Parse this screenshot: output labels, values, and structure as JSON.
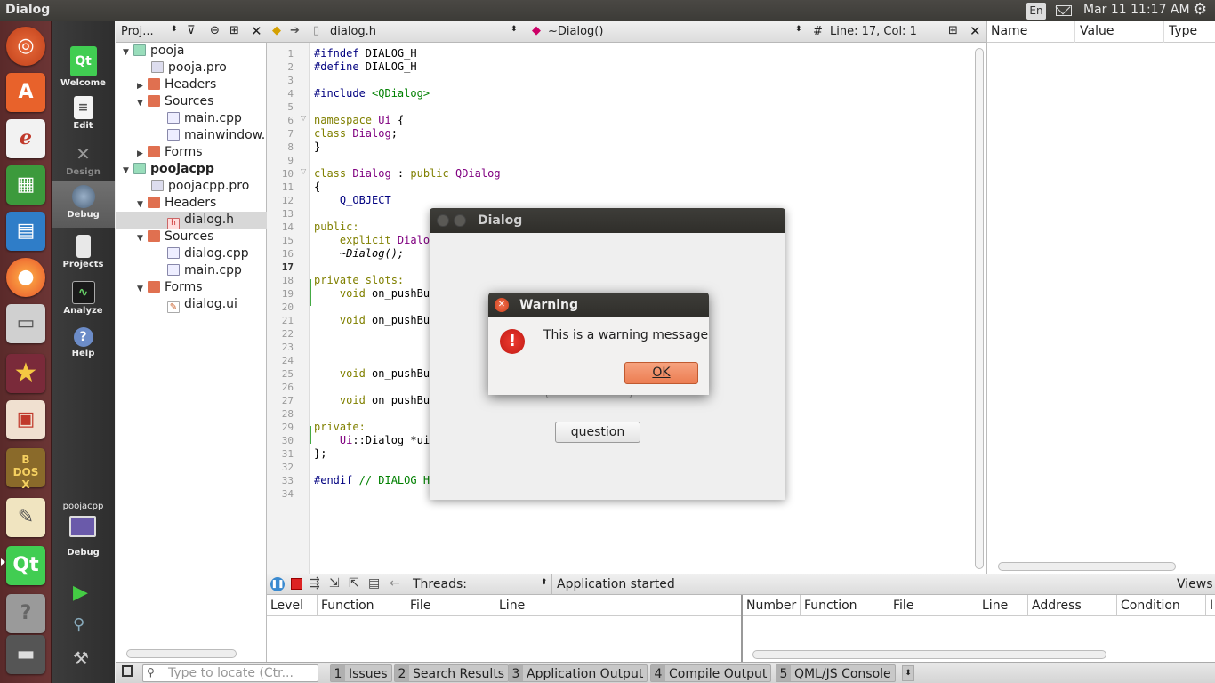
{
  "topbar": {
    "window_title": "Dialog",
    "keyboard": "En",
    "clock": "Mar 11 11:17 AM"
  },
  "modes": [
    {
      "label": "Welcome"
    },
    {
      "label": "Edit"
    },
    {
      "label": "Design"
    },
    {
      "label": "Debug"
    },
    {
      "label": "Projects"
    },
    {
      "label": "Analyze"
    },
    {
      "label": "Help"
    }
  ],
  "run_target": {
    "project": "poojacpp",
    "mode": "Debug"
  },
  "project_panel": {
    "filter_label": "Proj...",
    "tree": [
      {
        "label": "pooja",
        "bold": false
      },
      {
        "label": "pooja.pro"
      },
      {
        "label": "Headers"
      },
      {
        "label": "Sources"
      },
      {
        "label": "main.cpp"
      },
      {
        "label": "mainwindow."
      },
      {
        "label": "Forms"
      },
      {
        "label": "poojacpp",
        "bold": true
      },
      {
        "label": "poojacpp.pro"
      },
      {
        "label": "Headers"
      },
      {
        "label": "dialog.h"
      },
      {
        "label": "Sources"
      },
      {
        "label": "dialog.cpp"
      },
      {
        "label": "main.cpp"
      },
      {
        "label": "Forms"
      },
      {
        "label": "dialog.ui"
      }
    ]
  },
  "editor": {
    "file": "dialog.h",
    "symbol": "~Dialog()",
    "position": "Line: 17, Col: 1",
    "hash": "#",
    "line_numbers": [
      "1",
      "2",
      "3",
      "4",
      "5",
      "6",
      "7",
      "8",
      "9",
      "10",
      "11",
      "12",
      "13",
      "14",
      "15",
      "16",
      "17",
      "18",
      "19",
      "20",
      "21",
      "22",
      "23",
      "24",
      "25",
      "26",
      "27",
      "28",
      "29",
      "30",
      "31",
      "32",
      "33",
      "34"
    ],
    "lines": {
      "l1a": "#ifndef",
      "l1b": " DIALOG_H",
      "l2a": "#define",
      "l2b": " DIALOG_H",
      "l4a": "#include",
      "l4b": " <QDialog>",
      "l6a": "namespace",
      "l6b": " Ui",
      "l6c": " {",
      "l7a": "class",
      "l7b": " Dialog",
      "l7c": ";",
      "l8": "}",
      "l10a": "class",
      "l10b": " Dialog",
      "l10c": " : ",
      "l10d": "public",
      "l10e": " QDialog",
      "l11": "{",
      "l12": "    Q_OBJECT",
      "l14": "public:",
      "l15a": "    explicit",
      "l15b": " Dialo",
      "l16": "    ~Dialog();",
      "l18": "private slots:",
      "l19a": "    void",
      "l19b": " on_pushBu",
      "l21a": "    void",
      "l21b": " on_pushBu",
      "l25a": "    void",
      "l25b": " on_pushBu",
      "l27a": "    void",
      "l27b": " on_pushBu",
      "l29": "private:",
      "l30a": "    Ui",
      "l30b": "::Dialog *ui",
      "l31": "};",
      "l33a": "#endif",
      "l33b": " // DIALOG_H"
    }
  },
  "right_panel": {
    "columns": [
      "Name",
      "Value",
      "Type"
    ]
  },
  "debug_bar": {
    "threads_label": "Threads:",
    "status": "Application started",
    "views": "Views"
  },
  "stack_columns": [
    "Level",
    "Function",
    "File",
    "Line"
  ],
  "breakpoint_columns": [
    "Number",
    "Function",
    "File",
    "Line",
    "Address",
    "Condition",
    "I"
  ],
  "statusbar": {
    "locate_placeholder": "Type to locate (Ctr...",
    "tabs": [
      {
        "num": "1",
        "label": "Issues"
      },
      {
        "num": "2",
        "label": "Search Results"
      },
      {
        "num": "3",
        "label": "Application Output"
      },
      {
        "num": "4",
        "label": "Compile Output"
      },
      {
        "num": "5",
        "label": "QML/JS Console"
      }
    ]
  },
  "dialog": {
    "title": "Dialog",
    "question_button": "question"
  },
  "warning": {
    "title": "Warning",
    "message": "This is a warning message",
    "ok": "OK"
  },
  "colors": {
    "ubuntu_orange": "#e95420",
    "qt_green": "#41cd52",
    "warning_red": "#d8231e",
    "ok_button": "#f08a5d"
  }
}
